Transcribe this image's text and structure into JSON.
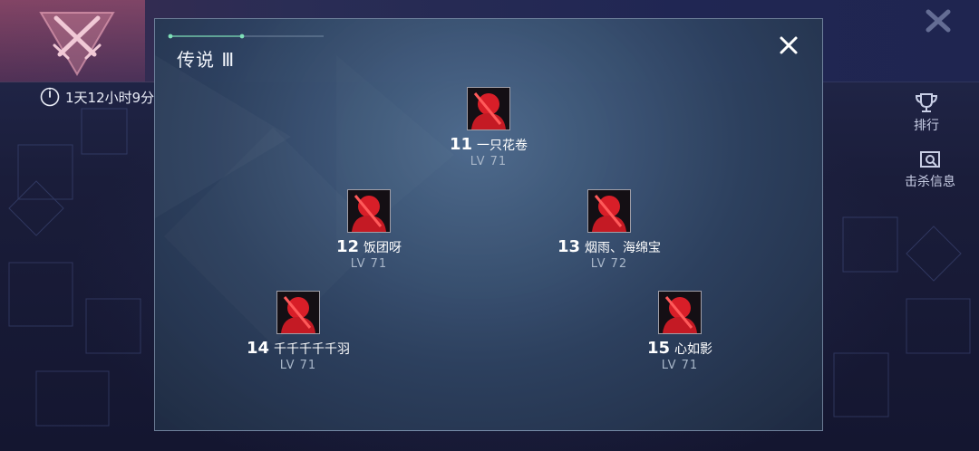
{
  "header": {
    "timer_text": "1天12小时9分"
  },
  "side_menu": {
    "ranking_label": "排行",
    "kill_info_label": "击杀信息"
  },
  "modal": {
    "title": "传说 Ⅲ",
    "players": [
      {
        "rank": "11",
        "name": "一只花卷",
        "level": "LV  71"
      },
      {
        "rank": "12",
        "name": "饭团呀",
        "level": "LV  71"
      },
      {
        "rank": "13",
        "name": "烟雨、海绵宝",
        "level": "LV  72"
      },
      {
        "rank": "14",
        "name": "千千千千千羽",
        "level": "LV  71"
      },
      {
        "rank": "15",
        "name": "心如影",
        "level": "LV  71"
      }
    ]
  },
  "icons": {
    "emblem": "crossed-swords-emblem-icon",
    "timer": "clock-icon",
    "close": "close-icon",
    "ranking": "trophy-icon",
    "kill_info": "kill-info-icon",
    "avatar": "red-silhouette-avatar-icon"
  },
  "colors": {
    "avatar_red": "#e0202a",
    "modal_border": "#aabed7",
    "accent_green": "#7fe0b8"
  }
}
